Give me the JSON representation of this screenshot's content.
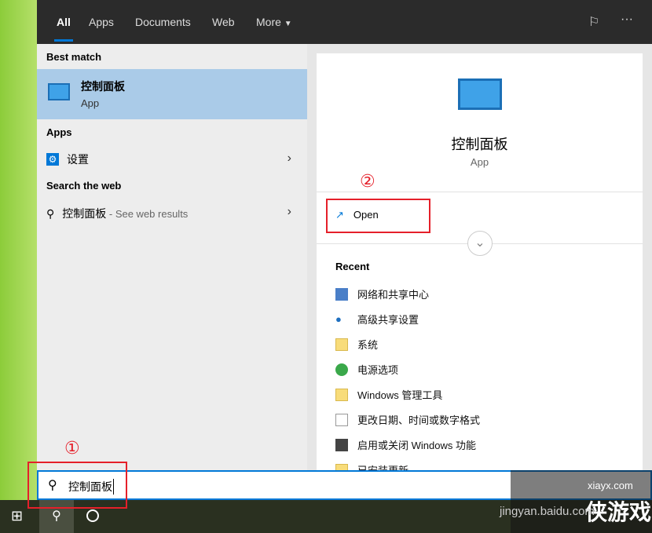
{
  "tabs": [
    {
      "label": "All"
    },
    {
      "label": "Apps"
    },
    {
      "label": "Documents"
    },
    {
      "label": "Web"
    },
    {
      "label": "More"
    }
  ],
  "left": {
    "best_match_header": "Best match",
    "best": {
      "title": "控制面板",
      "subtitle": "App"
    },
    "apps_header": "Apps",
    "app_item": "设置",
    "web_header": "Search the web",
    "web_item": "控制面板",
    "web_suffix": " - See web results"
  },
  "right": {
    "title": "控制面板",
    "subtitle": "App",
    "open": "Open",
    "recent_header": "Recent",
    "recent": [
      "网络和共享中心",
      "高级共享设置",
      "系统",
      "电源选项",
      "Windows 管理工具",
      "更改日期、时间或数字格式",
      "启用或关闭 Windows 功能",
      "已安装更新"
    ]
  },
  "search": {
    "value": "控制面板"
  },
  "annotations": {
    "one": "①",
    "two": "②"
  },
  "watermark": {
    "site": "xiayx.com",
    "brand": "侠游戏",
    "sub": "jingyan.baidu.com"
  },
  "colors": {
    "accent": "#0078d7",
    "highlight": "#aacbe8",
    "annotation": "#e5202a"
  }
}
